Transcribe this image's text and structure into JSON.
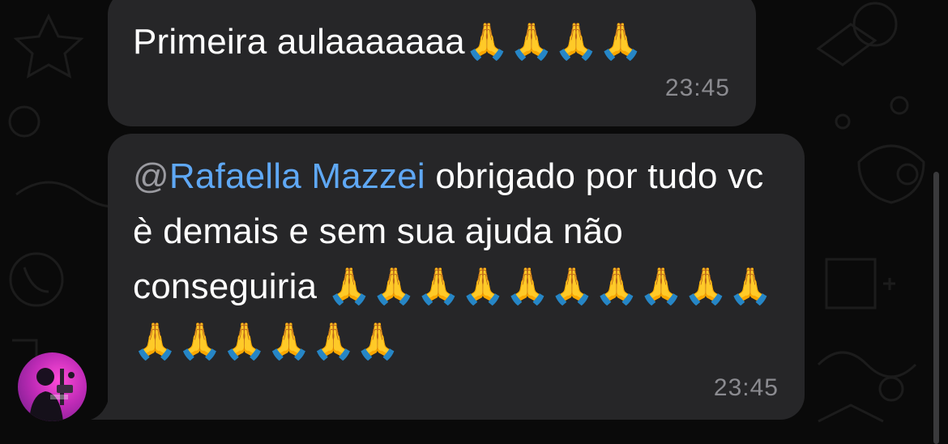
{
  "messages": [
    {
      "text": "Primeira aulaaaaaaa🙏🙏🙏🙏",
      "time": "23:45"
    },
    {
      "mention_at": "@",
      "mention_name": "Rafaella Mazzei",
      "text": " obrigado por tudo vc è demais e sem sua ajuda não conseguiria 🙏🙏🙏🙏🙏🙏🙏🙏🙏🙏🙏🙏🙏🙏🙏🙏",
      "time": "23:45"
    }
  ],
  "colors": {
    "bubble": "#262628",
    "mention": "#5fa8f5",
    "time": "#8b8b90",
    "background": "#0a0a0a"
  }
}
